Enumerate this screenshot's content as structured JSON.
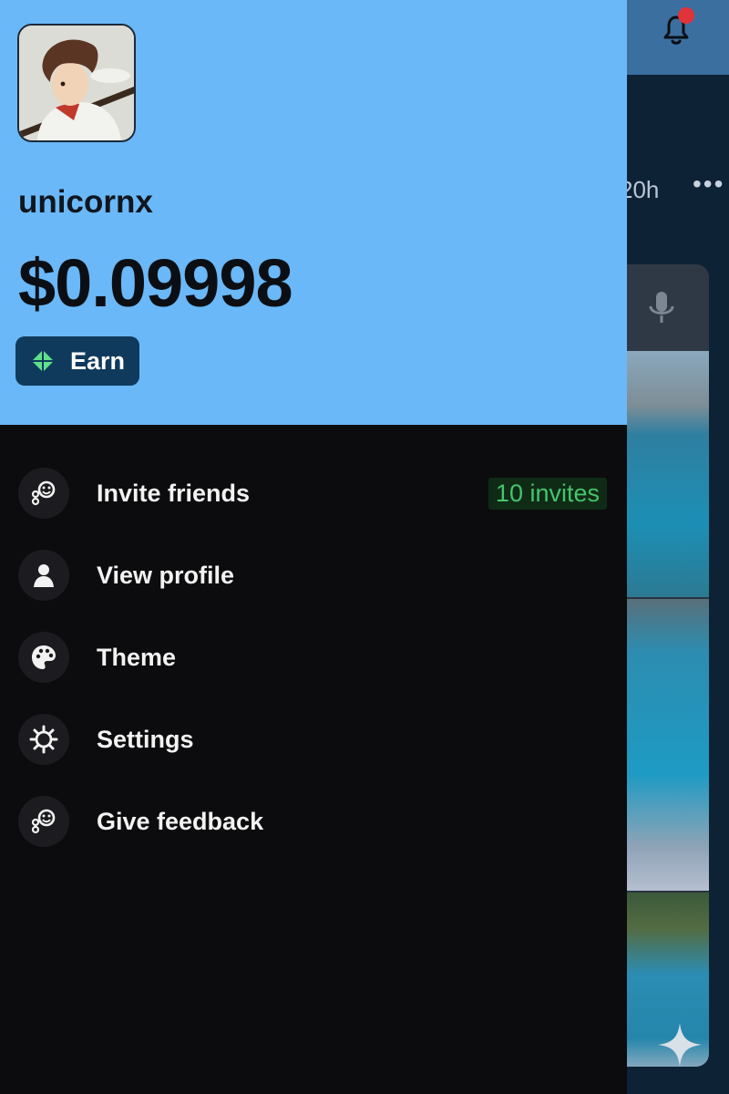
{
  "background": {
    "time_label": "20h",
    "more_label": "•••",
    "bell_icon": "bell-icon",
    "mic_icon": "microphone-icon",
    "sparkle_icon": "sparkle-icon"
  },
  "drawer": {
    "username": "unicornx",
    "balance": "$0.09998",
    "earn_label": "Earn",
    "earn_icon": "diamond-icon",
    "header_color": "#6ab8f8",
    "menu": [
      {
        "label": "Invite friends",
        "icon": "friends-icon",
        "badge": "10 invites"
      },
      {
        "label": "View profile",
        "icon": "person-icon"
      },
      {
        "label": "Theme",
        "icon": "palette-icon"
      },
      {
        "label": "Settings",
        "icon": "gear-icon"
      },
      {
        "label": "Give feedback",
        "icon": "feedback-icon"
      }
    ]
  },
  "colors": {
    "accent_green": "#45c46b",
    "notification_dot": "#e0333a"
  }
}
